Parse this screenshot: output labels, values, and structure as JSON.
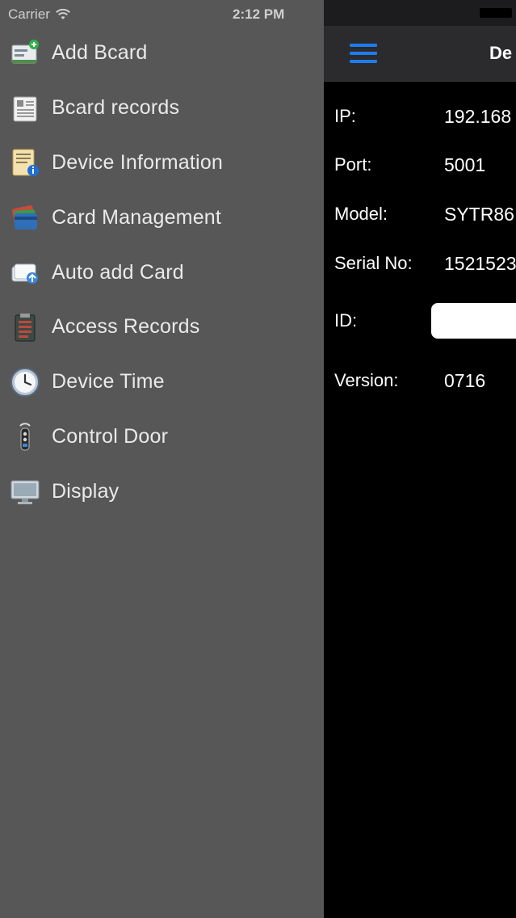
{
  "status_bar": {
    "carrier": "Carrier",
    "time": "2:12 PM"
  },
  "menu": {
    "items": [
      {
        "label": "Add Bcard",
        "icon": "add-bcard-icon"
      },
      {
        "label": "Bcard records",
        "icon": "bcard-records-icon"
      },
      {
        "label": "Device Information",
        "icon": "device-information-icon"
      },
      {
        "label": "Card Management",
        "icon": "card-management-icon"
      },
      {
        "label": "Auto add Card",
        "icon": "auto-add-card-icon"
      },
      {
        "label": "Access Records",
        "icon": "access-records-icon"
      },
      {
        "label": "Device Time",
        "icon": "clock-icon"
      },
      {
        "label": "Control Door",
        "icon": "door-remote-icon"
      },
      {
        "label": "Display",
        "icon": "monitor-icon"
      }
    ]
  },
  "navbar": {
    "title": "De",
    "menu_icon": "hamburger-menu-icon",
    "accent_color": "#1e7cf0"
  },
  "device_info": {
    "ip_label": "IP:",
    "ip_value": "192.168",
    "port_label": "Port:",
    "port_value": "5001",
    "model_label": "Model:",
    "model_value": "SYTR86",
    "serial_label": "Serial No:",
    "serial_value": "1521523",
    "id_label": "ID:",
    "id_value": "",
    "version_label": "Version:",
    "version_value": "0716"
  },
  "colors": {
    "drawer_bg": "#575758",
    "main_bg": "#000000",
    "navbar_bg": "#2b2b2d"
  }
}
